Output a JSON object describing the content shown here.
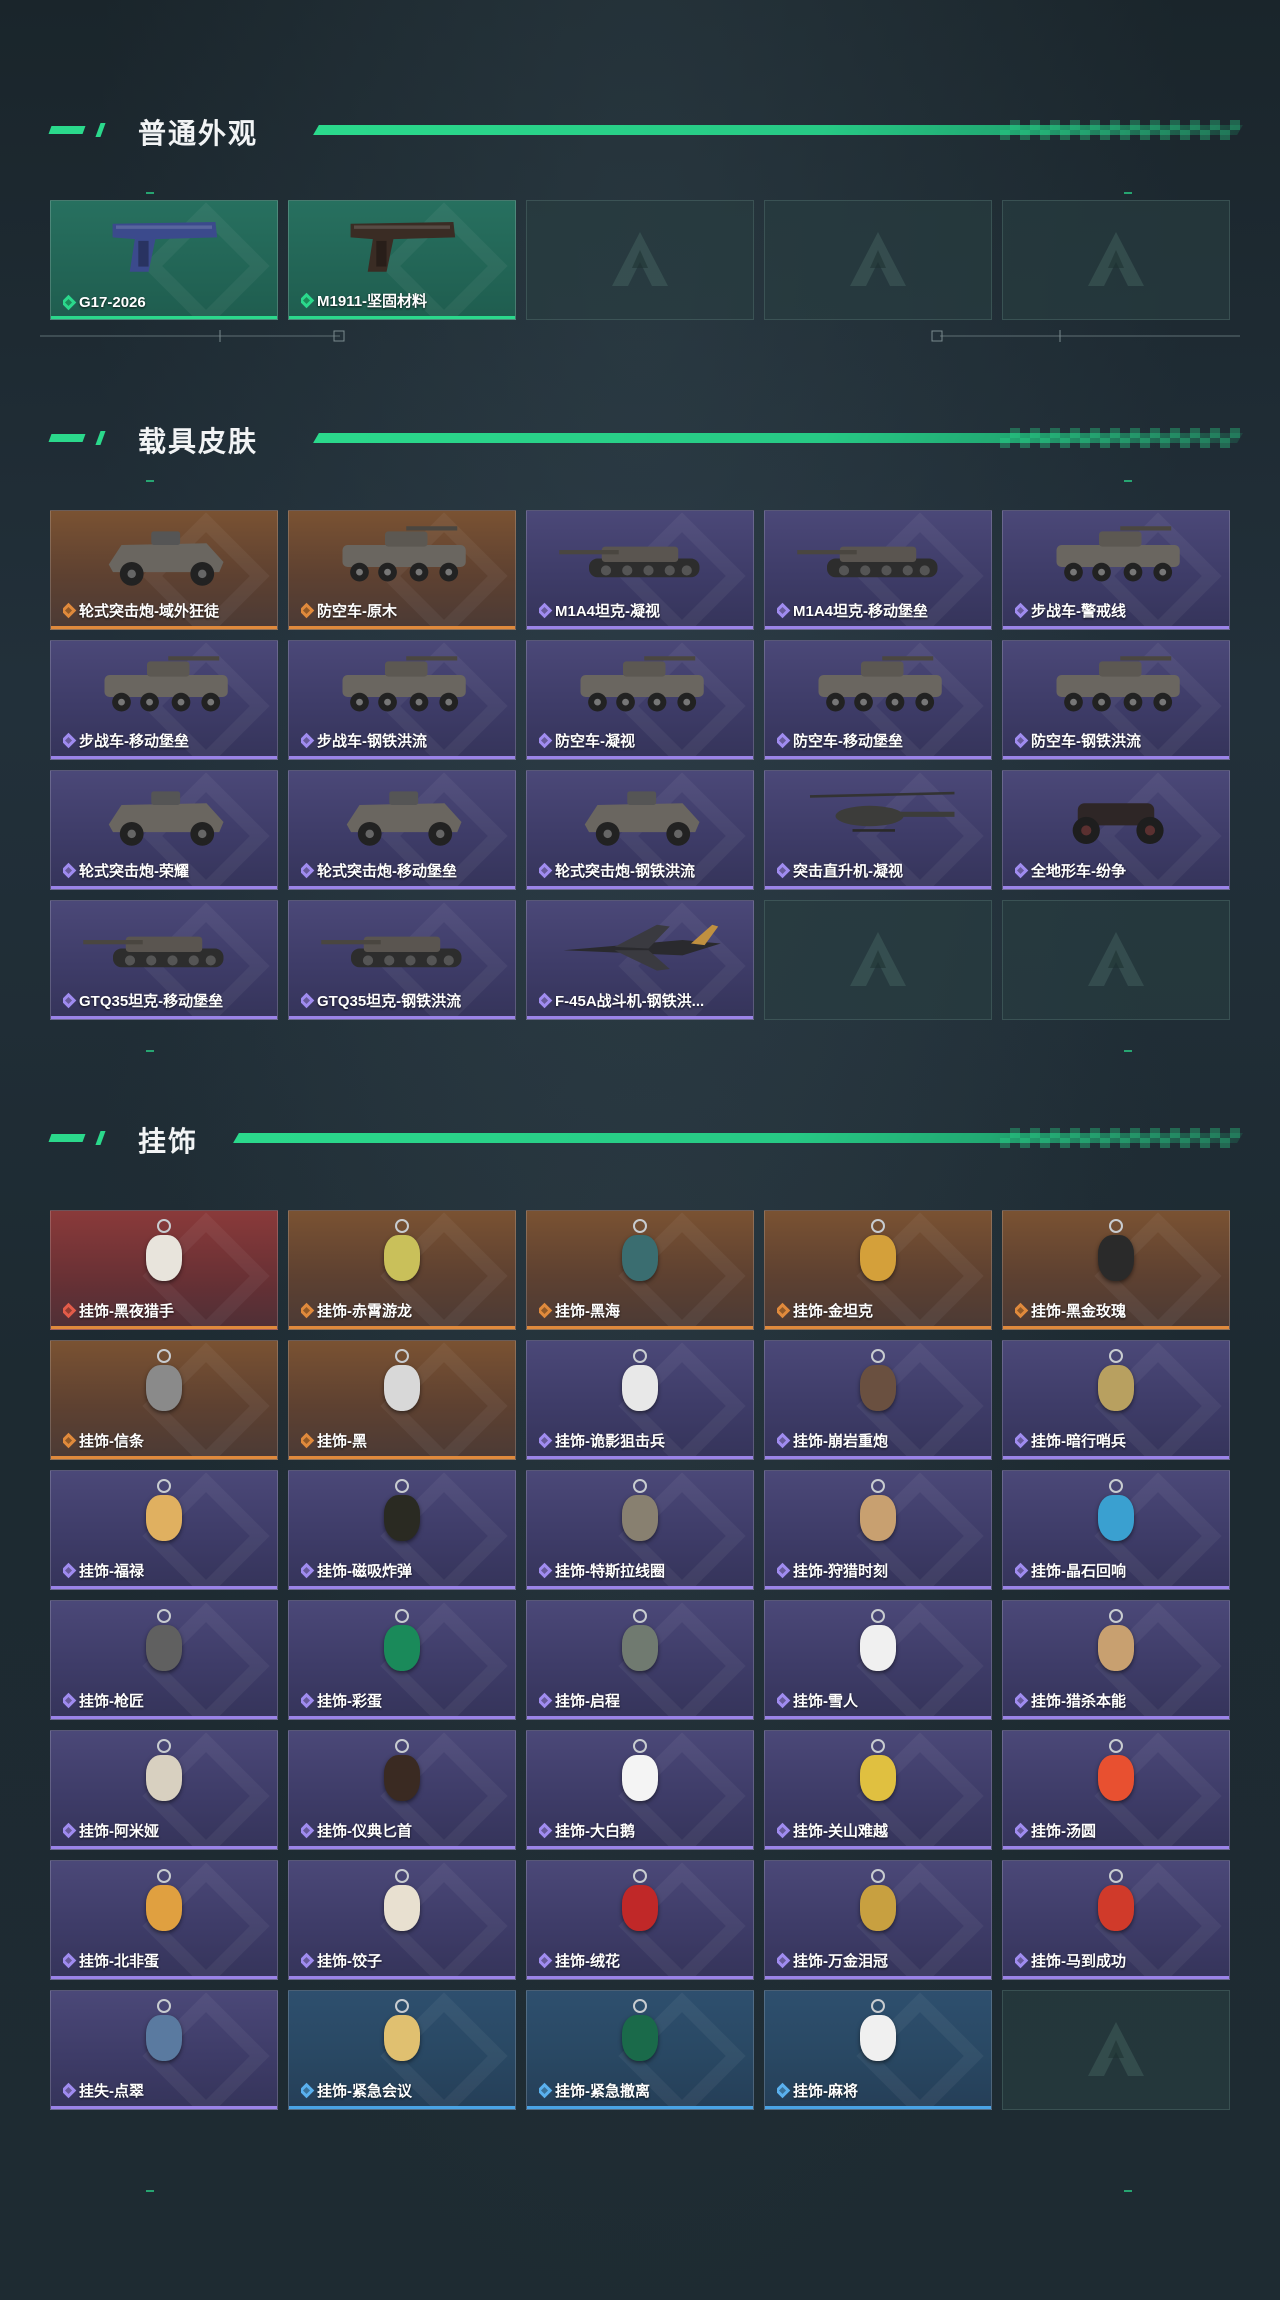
{
  "sections": {
    "normal": {
      "title": "普通外观"
    },
    "vehicle": {
      "title": "载具皮肤"
    },
    "charm": {
      "title": "挂饰"
    }
  },
  "colors": {
    "accent": "#2bd98c",
    "rarity_green": "#2bd98c",
    "rarity_orange": "#e08a3c",
    "rarity_red": "#e25c4a",
    "rarity_purple": "#a08cf0",
    "rarity_blue": "#5ab0ee"
  },
  "normal_items": [
    {
      "name": "G17-2026",
      "rarity": "green",
      "icon": "pistol-icon",
      "tint": "#3b4a8c"
    },
    {
      "name": "M1911-坚固材料",
      "rarity": "green",
      "icon": "pistol-icon",
      "tint": "#3a2c24"
    },
    {
      "empty": true
    },
    {
      "empty": true
    },
    {
      "empty": true
    }
  ],
  "vehicle_items": [
    {
      "name": "轮式突击炮-域外狂徒",
      "rarity": "orange",
      "icon": "armored-car-icon"
    },
    {
      "name": "防空车-原木",
      "rarity": "orange",
      "icon": "wheeled-vehicle-icon"
    },
    {
      "name": "M1A4坦克-凝视",
      "rarity": "purple",
      "icon": "tank-icon"
    },
    {
      "name": "M1A4坦克-移动堡垒",
      "rarity": "purple",
      "icon": "tank-icon"
    },
    {
      "name": "步战车-警戒线",
      "rarity": "purple",
      "icon": "wheeled-vehicle-icon"
    },
    {
      "name": "步战车-移动堡垒",
      "rarity": "purple",
      "icon": "wheeled-vehicle-icon"
    },
    {
      "name": "步战车-钢铁洪流",
      "rarity": "purple",
      "icon": "wheeled-vehicle-icon"
    },
    {
      "name": "防空车-凝视",
      "rarity": "purple",
      "icon": "wheeled-vehicle-icon"
    },
    {
      "name": "防空车-移动堡垒",
      "rarity": "purple",
      "icon": "wheeled-vehicle-icon"
    },
    {
      "name": "防空车-钢铁洪流",
      "rarity": "purple",
      "icon": "wheeled-vehicle-icon"
    },
    {
      "name": "轮式突击炮-荣耀",
      "rarity": "purple",
      "icon": "armored-car-icon"
    },
    {
      "name": "轮式突击炮-移动堡垒",
      "rarity": "purple",
      "icon": "armored-car-icon"
    },
    {
      "name": "轮式突击炮-钢铁洪流",
      "rarity": "purple",
      "icon": "armored-car-icon"
    },
    {
      "name": "突击直升机-凝视",
      "rarity": "purple",
      "icon": "helicopter-icon"
    },
    {
      "name": "全地形车-纷争",
      "rarity": "purple",
      "icon": "atv-icon"
    },
    {
      "name": "GTQ35坦克-移动堡垒",
      "rarity": "purple",
      "icon": "tank-icon"
    },
    {
      "name": "GTQ35坦克-钢铁洪流",
      "rarity": "purple",
      "icon": "tank-icon"
    },
    {
      "name": "F-45A战斗机-钢铁洪...",
      "rarity": "purple",
      "icon": "jet-icon"
    },
    {
      "empty": true
    },
    {
      "empty": true
    }
  ],
  "charm_items": [
    {
      "name": "挂饰-黑夜猎手",
      "rarity": "red",
      "tint": "#e8e4dc"
    },
    {
      "name": "挂饰-赤霄游龙",
      "rarity": "orange",
      "tint": "#c9c05a"
    },
    {
      "name": "挂饰-黑海",
      "rarity": "orange",
      "tint": "#3a6d70"
    },
    {
      "name": "挂饰-金坦克",
      "rarity": "orange",
      "tint": "#d4a03a"
    },
    {
      "name": "挂饰-黑金玫瑰",
      "rarity": "orange",
      "tint": "#2a2a2a"
    },
    {
      "name": "挂饰-信条",
      "rarity": "orange",
      "tint": "#8a8a8a"
    },
    {
      "name": "挂饰-黑",
      "rarity": "orange",
      "tint": "#d8d8d8"
    },
    {
      "name": "挂饰-诡影狙击兵",
      "rarity": "purple",
      "tint": "#e8e8e8"
    },
    {
      "name": "挂饰-崩岩重炮",
      "rarity": "purple",
      "tint": "#6a5040"
    },
    {
      "name": "挂饰-暗行哨兵",
      "rarity": "purple",
      "tint": "#b8a060"
    },
    {
      "name": "挂饰-福禄",
      "rarity": "purple",
      "tint": "#e0b060"
    },
    {
      "name": "挂饰-磁吸炸弹",
      "rarity": "purple",
      "tint": "#2a2a22"
    },
    {
      "name": "挂饰-特斯拉线圈",
      "rarity": "purple",
      "tint": "#888070"
    },
    {
      "name": "挂饰-狩猎时刻",
      "rarity": "purple",
      "tint": "#c8a070"
    },
    {
      "name": "挂饰-晶石回响",
      "rarity": "purple",
      "tint": "#3aa0d0"
    },
    {
      "name": "挂饰-枪匠",
      "rarity": "purple",
      "tint": "#606060"
    },
    {
      "name": "挂饰-彩蛋",
      "rarity": "purple",
      "tint": "#1a8a5a"
    },
    {
      "name": "挂饰-启程",
      "rarity": "purple",
      "tint": "#707a70"
    },
    {
      "name": "挂饰-雪人",
      "rarity": "purple",
      "tint": "#f0f0f0"
    },
    {
      "name": "挂饰-猎杀本能",
      "rarity": "purple",
      "tint": "#c8a070"
    },
    {
      "name": "挂饰-阿米娅",
      "rarity": "purple",
      "tint": "#d8d0c0"
    },
    {
      "name": "挂饰-仪典匕首",
      "rarity": "purple",
      "tint": "#3a2a22"
    },
    {
      "name": "挂饰-大白鹅",
      "rarity": "purple",
      "tint": "#f4f4f4"
    },
    {
      "name": "挂饰-关山难越",
      "rarity": "purple",
      "tint": "#e0c040"
    },
    {
      "name": "挂饰-汤圆",
      "rarity": "purple",
      "tint": "#e85030"
    },
    {
      "name": "挂饰-北非蛋",
      "rarity": "purple",
      "tint": "#e0a040"
    },
    {
      "name": "挂饰-饺子",
      "rarity": "purple",
      "tint": "#e8e0d0"
    },
    {
      "name": "挂饰-绒花",
      "rarity": "purple",
      "tint": "#c02828"
    },
    {
      "name": "挂饰-万金泪冠",
      "rarity": "purple",
      "tint": "#c8a040"
    },
    {
      "name": "挂饰-马到成功",
      "rarity": "purple",
      "tint": "#d03a2a"
    },
    {
      "name": "挂失-点翠",
      "rarity": "purple",
      "tint": "#5a7aa0"
    },
    {
      "name": "挂饰-紧急会议",
      "rarity": "blue",
      "tint": "#e0c070"
    },
    {
      "name": "挂饰-紧急撤离",
      "rarity": "blue",
      "tint": "#1a6a4a"
    },
    {
      "name": "挂饰-麻将",
      "rarity": "blue",
      "tint": "#f0f0f0"
    },
    {
      "empty": true
    }
  ]
}
